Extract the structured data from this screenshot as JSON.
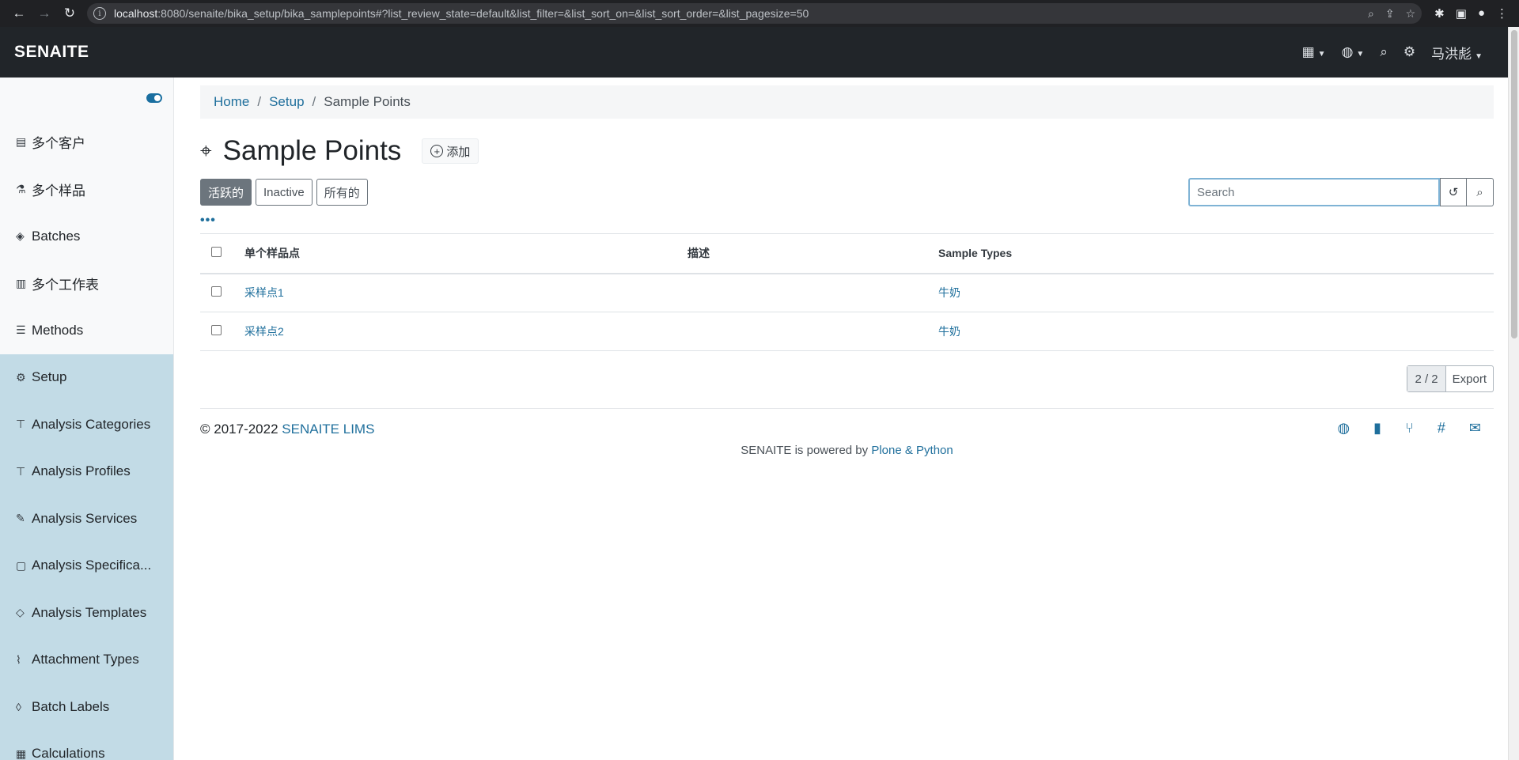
{
  "browser": {
    "url_host": "localhost",
    "url_rest": ":8080/senaite/bika_setup/bika_samplepoints#?list_review_state=default&list_filter=&list_sort_on=&list_sort_order=&list_pagesize=50"
  },
  "navbar": {
    "brand": "SENAITE",
    "user": "马洪彪"
  },
  "sidebar": {
    "items": [
      {
        "label": "多个客户",
        "icon": "building-icon"
      },
      {
        "label": "多个样品",
        "icon": "flask-icon"
      },
      {
        "label": "Batches",
        "icon": "layers-icon"
      },
      {
        "label": "多个工作表",
        "icon": "clipboard-icon"
      },
      {
        "label": "Methods",
        "icon": "list-icon"
      },
      {
        "label": "Setup",
        "icon": "gears-icon"
      },
      {
        "label": "Analysis Categories",
        "icon": "sitemap-icon"
      },
      {
        "label": "Analysis Profiles",
        "icon": "sitemap-icon"
      },
      {
        "label": "Analysis Services",
        "icon": "service-icon"
      },
      {
        "label": "Analysis Specifica...",
        "icon": "spec-icon"
      },
      {
        "label": "Analysis Templates",
        "icon": "cube-icon"
      },
      {
        "label": "Attachment Types",
        "icon": "paperclip-icon"
      },
      {
        "label": "Batch Labels",
        "icon": "tags-icon"
      },
      {
        "label": "Calculations",
        "icon": "calculator-icon"
      }
    ]
  },
  "breadcrumb": {
    "home": "Home",
    "setup": "Setup",
    "current": "Sample Points"
  },
  "page": {
    "title": "Sample Points",
    "add_label": "添加"
  },
  "filters": {
    "active": "活跃的",
    "inactive": "Inactive",
    "all": "所有的"
  },
  "search": {
    "placeholder": "Search"
  },
  "table": {
    "headers": [
      "单个样品点",
      "描述",
      "Sample Types"
    ],
    "rows": [
      {
        "name": "采样点1",
        "description": "",
        "sample_types": "牛奶"
      },
      {
        "name": "采样点2",
        "description": "",
        "sample_types": "牛奶"
      }
    ]
  },
  "pager": {
    "count": "2 / 2",
    "export": "Export"
  },
  "footer": {
    "copyright": "© 2017-2022 ",
    "lims": "SENAITE LIMS",
    "powered_prefix": "SENAITE is powered by ",
    "powered_link": "Plone & Python"
  },
  "colors": {
    "navbar": "#212529",
    "setup_highlight": "#c2dbe6",
    "link": "#1f6f9c"
  }
}
